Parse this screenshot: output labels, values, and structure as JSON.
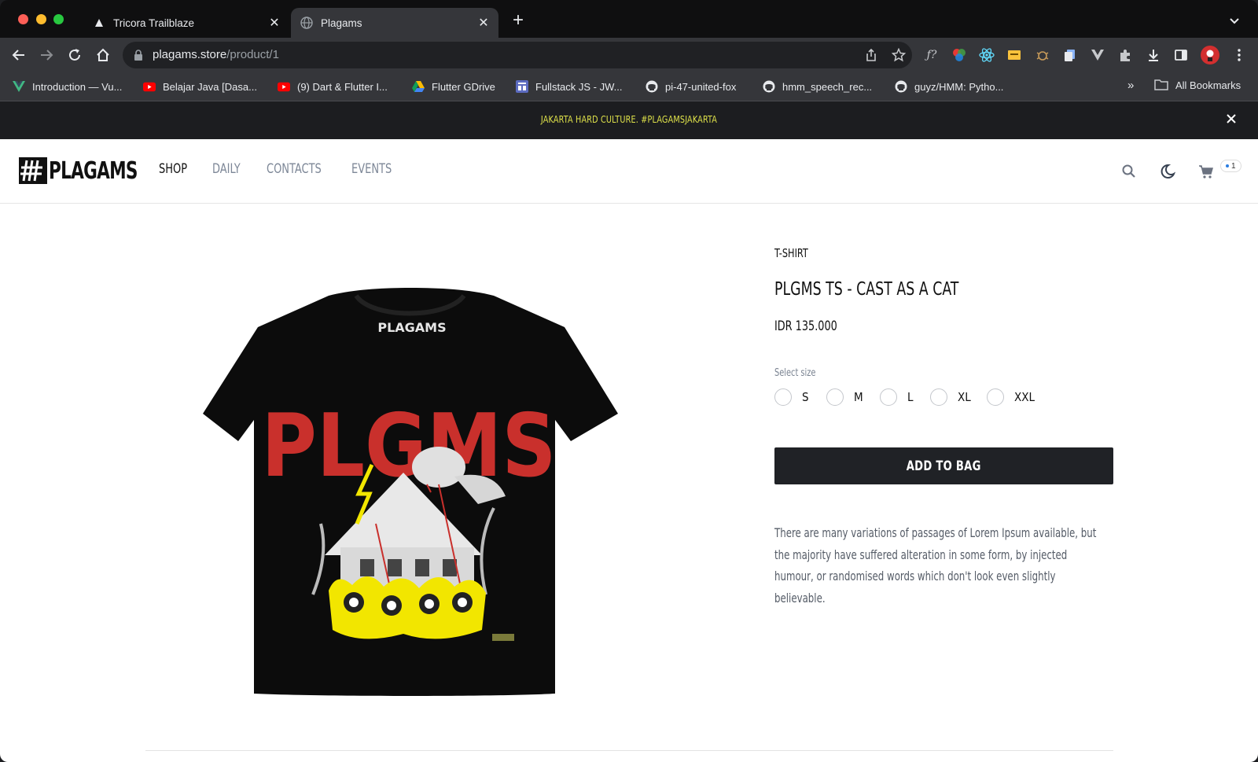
{
  "browser": {
    "tabs": [
      {
        "title": "Tricora Trailblaze",
        "active": false,
        "icon": "triangle-icon"
      },
      {
        "title": "Plagams",
        "active": true,
        "icon": "globe-icon"
      }
    ],
    "url": {
      "domain": "plagams.store",
      "path": "/product/1"
    },
    "bookmarks": [
      {
        "label": "Introduction — Vu...",
        "icon": "vue-icon"
      },
      {
        "label": "Belajar Java [Dasa...",
        "icon": "youtube-icon"
      },
      {
        "label": "(9) Dart & Flutter I...",
        "icon": "youtube-icon"
      },
      {
        "label": "Flutter GDrive",
        "icon": "gdrive-icon"
      },
      {
        "label": "Fullstack JS - JW...",
        "icon": "board-icon"
      },
      {
        "label": "pi-47-united-fox",
        "icon": "github-icon"
      },
      {
        "label": "hmm_speech_rec...",
        "icon": "github-icon"
      },
      {
        "label": "guyz/HMM: Pytho...",
        "icon": "github-icon"
      }
    ],
    "bookmarks_more": "»",
    "all_bookmarks": "All Bookmarks"
  },
  "site": {
    "announcement": "JAKARTA HARD CULTURE. #PLAGAMSJAKARTA",
    "logo": "PLAGAMS",
    "menu": [
      {
        "label": "SHOP",
        "active": true
      },
      {
        "label": "DAILY",
        "active": false
      },
      {
        "label": "CONTACTS",
        "active": false
      },
      {
        "label": "EVENTS",
        "active": false
      }
    ],
    "cart_count": "1"
  },
  "product": {
    "category": "T-SHIRT",
    "title": "PLGMS TS - CAST AS A CAT",
    "price": "IDR 135.000",
    "size_label": "Select size",
    "sizes": [
      "S",
      "M",
      "L",
      "XL",
      "XXL"
    ],
    "add_to_bag": "ADD TO BAG",
    "description": "There are many variations of passages of Lorem Ipsum available, but the majority have suffered alteration in some form, by injected humour, or randomised words which don't look even slightly believable.",
    "image_print": {
      "neck_label": "PLAGAMS",
      "graphic_text": "PLGMS"
    }
  },
  "colors": {
    "announcement_text": "#dfe24a",
    "button_bg": "#202226",
    "print_red": "#c9302c",
    "print_yellow": "#f2e600"
  }
}
